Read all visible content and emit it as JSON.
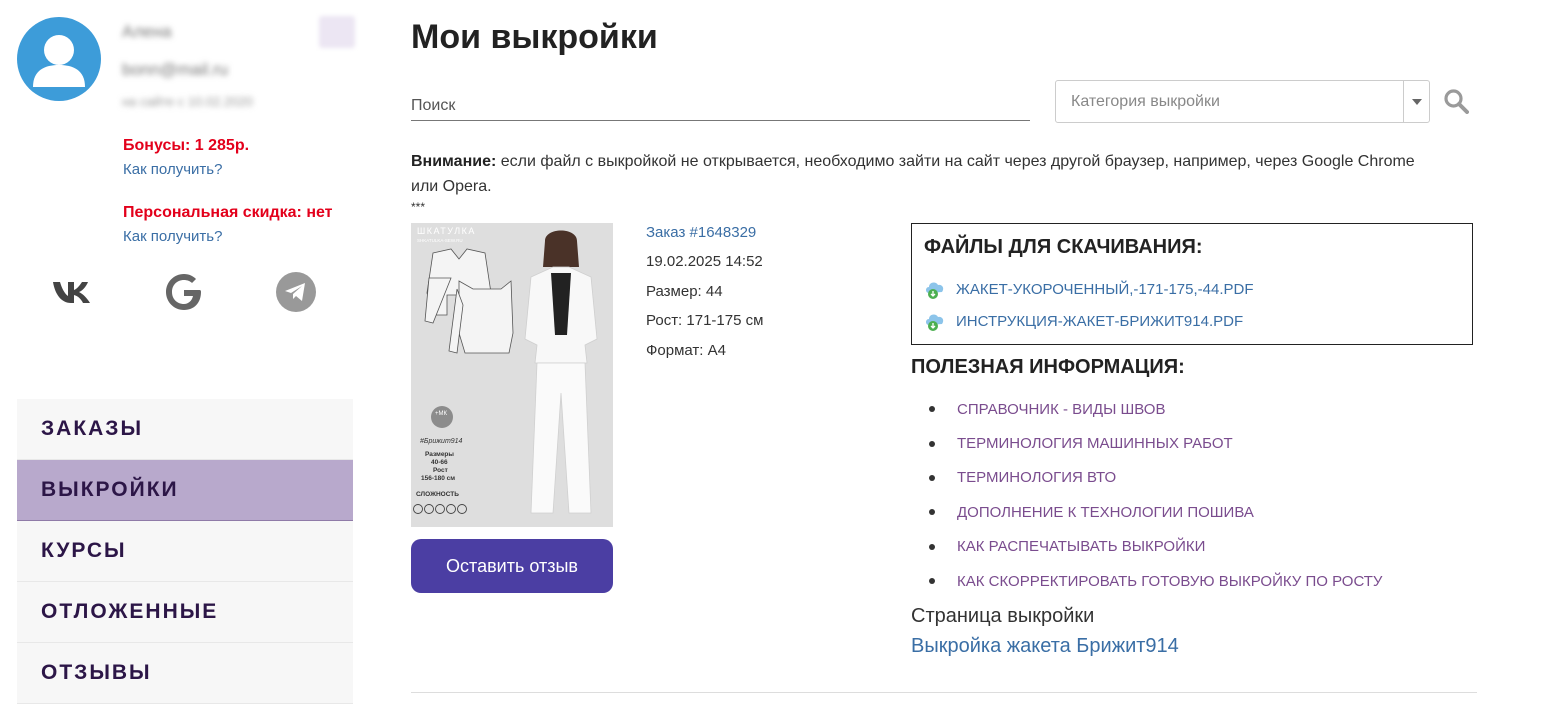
{
  "profile": {
    "name": "Алена",
    "email": "bonn@mail.ru",
    "registered": "на сайте с 10.02.2020",
    "bonus_text": "Бонусы: 1 285р.",
    "bonus_link": "Как получить?",
    "discount_text": "Персональная скидка: нет",
    "discount_link": "Как получить?"
  },
  "social": [
    {
      "name": "vk-icon",
      "color": "#444444"
    },
    {
      "name": "google-icon",
      "color": "#666666"
    },
    {
      "name": "telegram-icon",
      "color": "#999999"
    }
  ],
  "nav": {
    "items": [
      {
        "label": "ЗАКАЗЫ",
        "active": false
      },
      {
        "label": "ВЫКРОЙКИ",
        "active": true
      },
      {
        "label": "КУРСЫ",
        "active": false
      },
      {
        "label": "ОТЛОЖЕННЫЕ",
        "active": false
      },
      {
        "label": "ОТЗЫВЫ",
        "active": false
      }
    ]
  },
  "main": {
    "title": "Мои выкройки",
    "search_placeholder": "Поиск",
    "category_placeholder": "Категория выкройки",
    "notice_bold": "Внимание:",
    "notice_text": " если файл с выкройкой не открывается, необходимо зайти на сайт через другой браузер, например, через Google Chrome или Opera.",
    "stars": "***"
  },
  "product": {
    "image_brand": "ШКАТУЛКА",
    "image_site": "SHKATULKA-SEW.RU",
    "image_tag": "+МК",
    "image_name": "#Брижит914",
    "image_sizes_label": "Размеры",
    "image_sizes": "40-66",
    "image_height_label": "Рост",
    "image_height": "156-180 см",
    "image_difficulty": "СЛОЖНОСТЬ",
    "review_button": "Оставить отзыв"
  },
  "order": {
    "link": "Заказ #1648329",
    "date": "19.02.2025 14:52",
    "size": "Размер: 44",
    "height": "Рост: 171-175 см",
    "format": "Формат: А4"
  },
  "files": {
    "title": "ФАЙЛЫ ДЛЯ СКАЧИВАНИЯ:",
    "items": [
      "ЖАКЕТ-УКОРОЧЕННЫЙ,-171-175,-44.PDF",
      "ИНСТРУКЦИЯ-ЖАКЕТ-БРИЖИТ914.PDF"
    ]
  },
  "useful": {
    "title": "ПОЛЕЗНАЯ ИНФОРМАЦИЯ:",
    "items": [
      "СПРАВОЧНИК - ВИДЫ ШВОВ",
      "ТЕРМИНОЛОГИЯ МАШИННЫХ РАБОТ",
      "ТЕРМИНОЛОГИЯ ВТО",
      "ДОПОЛНЕНИЕ К ТЕХНОЛОГИИ ПОШИВА",
      "КАК РАСПЕЧАТЫВАТЬ ВЫКРОЙКИ",
      "КАК СКОРРЕКТИРОВАТЬ ГОТОВУЮ ВЫКРОЙКУ ПО РОСТУ"
    ]
  },
  "pattern_page": {
    "label": "Страница выкройки",
    "link": "Выкройка жакета Брижит914"
  },
  "colors": {
    "accent": "#4b3ea3",
    "nav_active": "#b8a9cc",
    "nav_text": "#2c1647",
    "warning": "#e3001b",
    "link": "#3a6ea5",
    "useful_link": "#7a4c8e",
    "avatar": "#3d9cd9"
  }
}
